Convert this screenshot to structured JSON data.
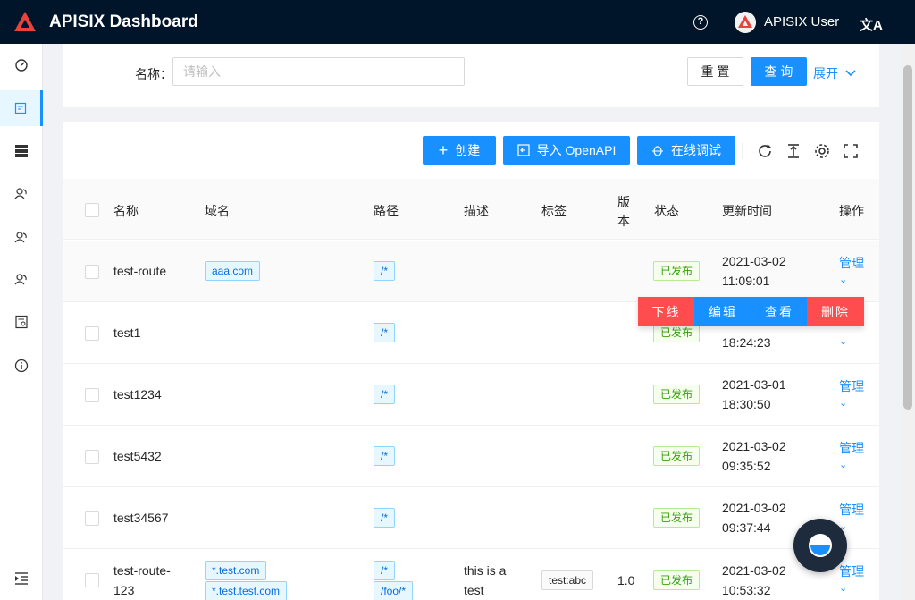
{
  "app": {
    "title": "APISIX Dashboard",
    "user": "APISIX User"
  },
  "filter": {
    "name_label": "名称：",
    "name_placeholder": "请输入",
    "reset_label": "重 置",
    "query_label": "查 询",
    "expand_label": "展开"
  },
  "toolbar": {
    "create_label": "创建",
    "import_label": "导入 OpenAPI",
    "debug_label": "在线调试"
  },
  "table": {
    "headers": {
      "name": "名称",
      "host": "域名",
      "path": "路径",
      "desc": "描述",
      "labels": "标签",
      "version_1": "版",
      "version_2": "本",
      "status": "状态",
      "updated": "更新时间",
      "actions": "操作"
    },
    "rows": [
      {
        "name": "test-route",
        "host": "aaa.com",
        "path": "/*",
        "status": "已发布",
        "date": "2021-03-02",
        "time": "11:09:01",
        "action": "管理"
      },
      {
        "name": "test1",
        "path": "/*",
        "status": "已发布",
        "time": "18:24:23"
      },
      {
        "name": "test1234",
        "path": "/*",
        "status": "已发布",
        "date": "2021-03-01",
        "time": "18:30:50",
        "action": "管理"
      },
      {
        "name": "test5432",
        "path": "/*",
        "status": "已发布",
        "date": "2021-03-02",
        "time": "09:35:52",
        "action": "管理"
      },
      {
        "name": "test34567",
        "path": "/*",
        "status": "已发布",
        "date": "2021-03-02",
        "time": "09:37:44",
        "action": "管理"
      },
      {
        "name_1": "test-route-",
        "name_2": "123",
        "host_1": "*.test.com",
        "host_2": "*.test.test.com",
        "path_1": "/*",
        "path_2": "/foo/*",
        "desc_1": "this is a",
        "desc_2": "test",
        "label": "test:abc",
        "version": "1.0",
        "status": "已发布",
        "date": "2021-03-02",
        "time": "10:53:32",
        "action": "管理"
      }
    ]
  },
  "popup": {
    "offline": "下线",
    "edit": "编辑",
    "view": "查看",
    "delete": "删除"
  },
  "colors": {
    "primary": "#1890ff",
    "danger": "#ff4d4f",
    "header": "#001529"
  }
}
